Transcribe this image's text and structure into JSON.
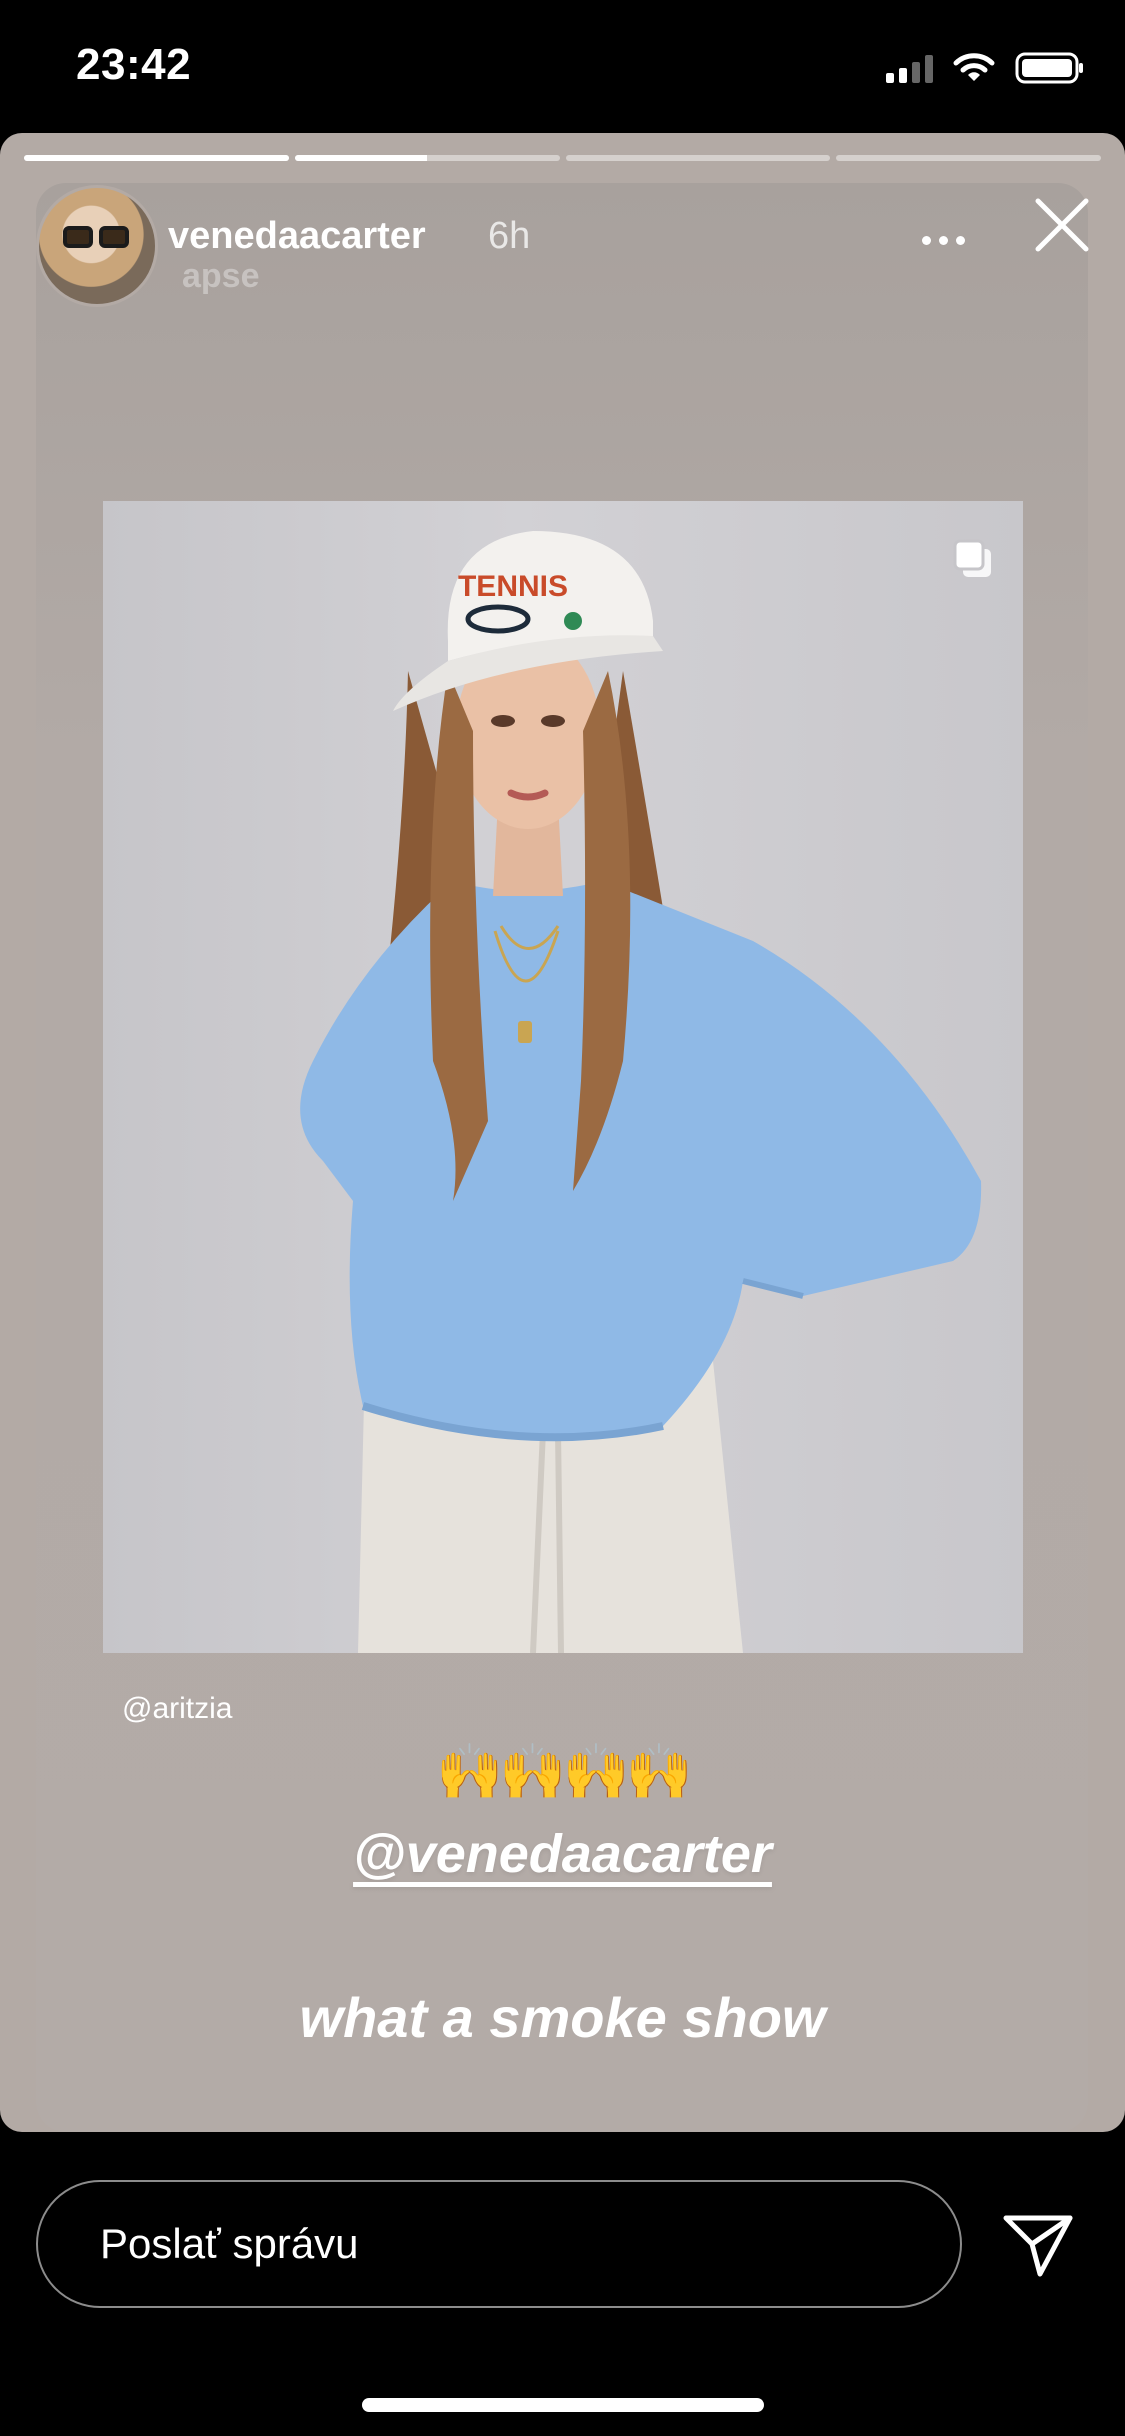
{
  "status_bar": {
    "time": "23:42"
  },
  "story": {
    "progress_segments": [
      1.0,
      0.5,
      0.0,
      0.0
    ],
    "user": {
      "username": "venedaacarter",
      "time_ago": "6h",
      "overlay_text": "apse"
    },
    "photo_caption_mention": "@aritzia",
    "emoji": "🙌🙌🙌🙌",
    "mention_tag": "@venedaacarter",
    "text": "what a smoke show"
  },
  "reply": {
    "placeholder": "Poslať správu"
  },
  "icons": {
    "more": "more-horizontal-icon",
    "close": "close-icon",
    "multiple": "multiple-posts-icon",
    "send": "send-direct-icon",
    "signal": "cellular-signal-icon",
    "wifi": "wifi-icon",
    "battery": "battery-icon"
  },
  "colors": {
    "background": "#000000",
    "story_background": "#b3aaa5"
  }
}
